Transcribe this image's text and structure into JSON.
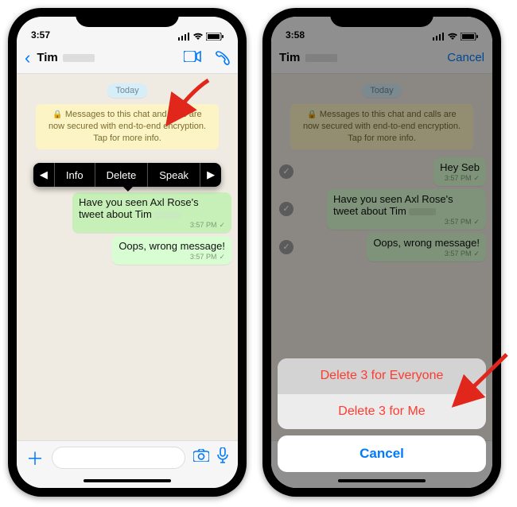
{
  "status": {
    "time_left": "3:57",
    "time_right": "3:58"
  },
  "header": {
    "contact": "Tim",
    "cancel": "Cancel"
  },
  "chat": {
    "day": "Today",
    "encryption": "Messages to this chat and calls are now secured with end-to-end encryption. Tap for more info.",
    "msg1": "Hey Seb",
    "msg2a": "Have you seen Axl Rose's tweet about Tim",
    "msg3": "Oops, wrong message!",
    "time": "3:57 PM"
  },
  "ctx": {
    "info": "Info",
    "delete": "Delete",
    "speak": "Speak"
  },
  "sheet": {
    "everyone": "Delete 3 for Everyone",
    "me": "Delete 3 for Me",
    "cancel": "Cancel"
  }
}
